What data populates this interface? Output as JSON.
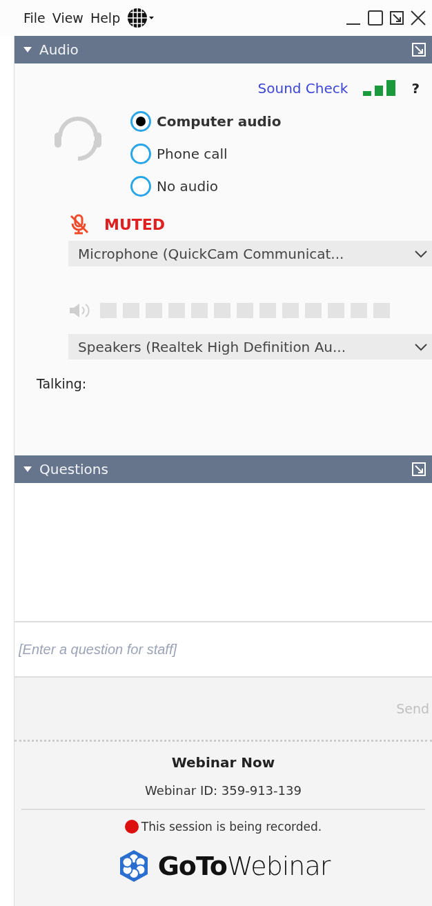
{
  "menu": [
    {
      "label": "File"
    },
    {
      "label": "View"
    },
    {
      "label": "Help"
    }
  ],
  "audio": {
    "title": "Audio",
    "expanded": true,
    "sound_check": "Sound Check",
    "help": "?",
    "options": [
      {
        "label": "Computer audio",
        "selected": true
      },
      {
        "label": "Phone call",
        "selected": false
      },
      {
        "label": "No audio",
        "selected": false
      }
    ],
    "muted": true,
    "muted_label": "MUTED",
    "microphone": "Microphone (QuickCam Communicat...",
    "speakers": "Speakers (Realtek High Definition Au...",
    "talking": "Talking:"
  },
  "questions": {
    "title": "Questions",
    "expanded": true,
    "placeholder": "[Enter a question for staff]",
    "send": "Send"
  },
  "footer": {
    "title": "Webinar Now",
    "webinar_id": "Webinar ID: 359-913-139",
    "recording": "This session is being recorded.",
    "logo": "**GoTo**Webinar"
  }
}
